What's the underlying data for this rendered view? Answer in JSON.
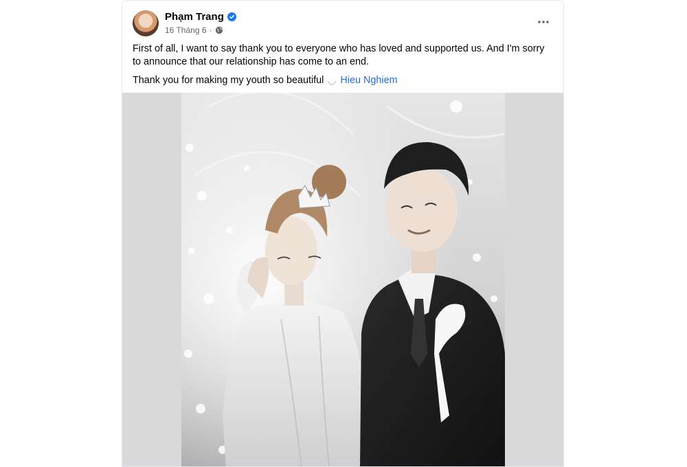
{
  "post": {
    "author": "Phạm Trang",
    "date": "16 Tháng 6",
    "paragraph1": "First of all, I want to say thank you to everyone who has loved and supported us. And I'm sorry to announce that our relationship has come to an end.",
    "paragraph2_text": "Thank you for making my youth so beautiful",
    "tagged_person": "Hieu Nghiem",
    "privacy_icon": "globe-icon",
    "verified_icon": "verified-badge-icon",
    "more_icon": "more-dots-icon"
  },
  "colors": {
    "verified": "#1877f2",
    "link": "#216fdb",
    "media_background": "#dadada"
  }
}
